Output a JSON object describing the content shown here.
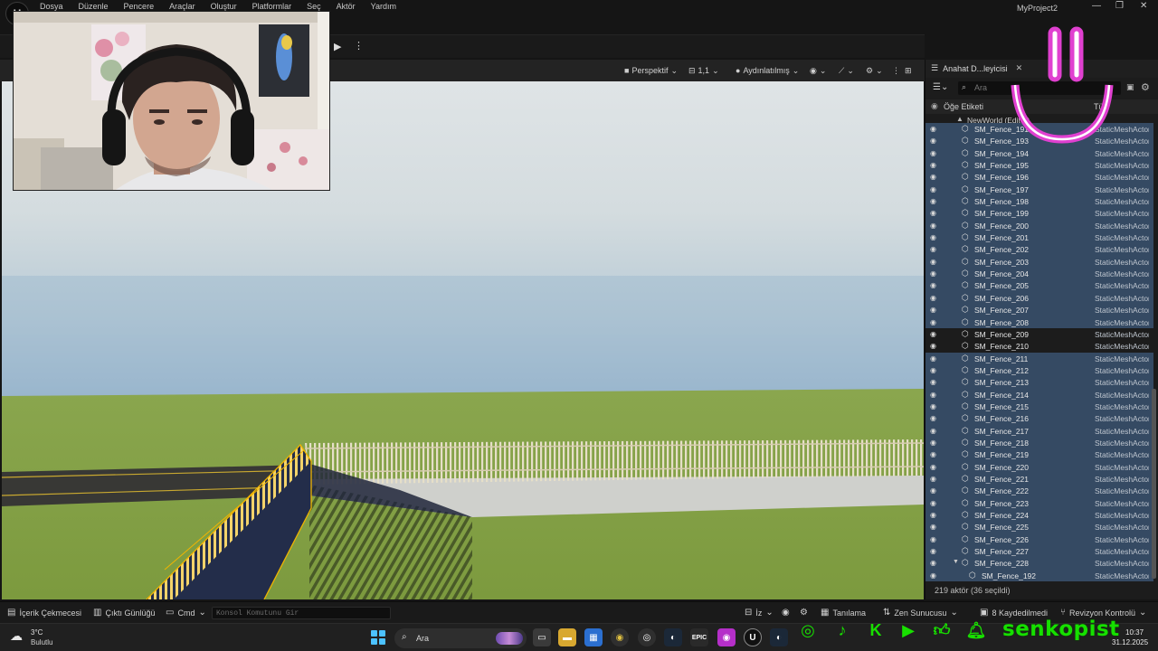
{
  "app": {
    "logo_glyph": "U",
    "menu": [
      "Dosya",
      "Düzenle",
      "Pencere",
      "Araçlar",
      "Oluştur",
      "Platformlar",
      "Seç",
      "Aktör",
      "Yardım"
    ],
    "project_title": "MyProject2",
    "window_controls": [
      "—",
      "❐",
      "✕"
    ]
  },
  "toolbar": {
    "play_glyph": "▶",
    "more_glyph": "⋮"
  },
  "viewport": {
    "view_mode": "Perspektif",
    "scale": "1,1",
    "lighting": "Aydınlatılmış",
    "show_glyph": "◉",
    "snap_glyph": "⚙",
    "layout_glyph": "⊞",
    "more_glyph": "⋮",
    "sky_color": "#c9d6dc",
    "ground_color": "#86a04a",
    "road_color": "#3a3a38",
    "fence_color": "#e4dcc4",
    "selection_color": "#f0b400"
  },
  "outliner": {
    "tab_label": "Anahat D...leyicisi",
    "tab_close": "✕",
    "search_placeholder": "Ara",
    "header_label": "Öğe Etiketi",
    "header_type": "Tür",
    "root_label": "NewWorld (Editör)",
    "rows": [
      {
        "name": "SM_Fence_191",
        "type": "StaticMeshActor",
        "selected": true
      },
      {
        "name": "SM_Fence_193",
        "type": "StaticMeshActor",
        "selected": true
      },
      {
        "name": "SM_Fence_194",
        "type": "StaticMeshActor",
        "selected": true
      },
      {
        "name": "SM_Fence_195",
        "type": "StaticMeshActor",
        "selected": true
      },
      {
        "name": "SM_Fence_196",
        "type": "StaticMeshActor",
        "selected": true
      },
      {
        "name": "SM_Fence_197",
        "type": "StaticMeshActor",
        "selected": true
      },
      {
        "name": "SM_Fence_198",
        "type": "StaticMeshActor",
        "selected": true
      },
      {
        "name": "SM_Fence_199",
        "type": "StaticMeshActor",
        "selected": true
      },
      {
        "name": "SM_Fence_200",
        "type": "StaticMeshActor",
        "selected": true
      },
      {
        "name": "SM_Fence_201",
        "type": "StaticMeshActor",
        "selected": true
      },
      {
        "name": "SM_Fence_202",
        "type": "StaticMeshActor",
        "selected": true
      },
      {
        "name": "SM_Fence_203",
        "type": "StaticMeshActor",
        "selected": true
      },
      {
        "name": "SM_Fence_204",
        "type": "StaticMeshActor",
        "selected": true
      },
      {
        "name": "SM_Fence_205",
        "type": "StaticMeshActor",
        "selected": true
      },
      {
        "name": "SM_Fence_206",
        "type": "StaticMeshActor",
        "selected": true
      },
      {
        "name": "SM_Fence_207",
        "type": "StaticMeshActor",
        "selected": true
      },
      {
        "name": "SM_Fence_208",
        "type": "StaticMeshActor",
        "selected": true
      },
      {
        "name": "SM_Fence_209",
        "type": "StaticMeshActor",
        "selected": false
      },
      {
        "name": "SM_Fence_210",
        "type": "StaticMeshActor",
        "selected": false
      },
      {
        "name": "SM_Fence_211",
        "type": "StaticMeshActor",
        "selected": true
      },
      {
        "name": "SM_Fence_212",
        "type": "StaticMeshActor",
        "selected": true
      },
      {
        "name": "SM_Fence_213",
        "type": "StaticMeshActor",
        "selected": true
      },
      {
        "name": "SM_Fence_214",
        "type": "StaticMeshActor",
        "selected": true
      },
      {
        "name": "SM_Fence_215",
        "type": "StaticMeshActor",
        "selected": true
      },
      {
        "name": "SM_Fence_216",
        "type": "StaticMeshActor",
        "selected": true
      },
      {
        "name": "SM_Fence_217",
        "type": "StaticMeshActor",
        "selected": true
      },
      {
        "name": "SM_Fence_218",
        "type": "StaticMeshActor",
        "selected": true
      },
      {
        "name": "SM_Fence_219",
        "type": "StaticMeshActor",
        "selected": true
      },
      {
        "name": "SM_Fence_220",
        "type": "StaticMeshActor",
        "selected": true
      },
      {
        "name": "SM_Fence_221",
        "type": "StaticMeshActor",
        "selected": true
      },
      {
        "name": "SM_Fence_222",
        "type": "StaticMeshActor",
        "selected": true
      },
      {
        "name": "SM_Fence_223",
        "type": "StaticMeshActor",
        "selected": true
      },
      {
        "name": "SM_Fence_224",
        "type": "StaticMeshActor",
        "selected": true
      },
      {
        "name": "SM_Fence_225",
        "type": "StaticMeshActor",
        "selected": true
      },
      {
        "name": "SM_Fence_226",
        "type": "StaticMeshActor",
        "selected": true
      },
      {
        "name": "SM_Fence_227",
        "type": "StaticMeshActor",
        "selected": true
      },
      {
        "name": "SM_Fence_228",
        "type": "StaticMeshActor",
        "selected": true,
        "expanded": true
      },
      {
        "name": "SM_Fence_192",
        "type": "StaticMeshActor",
        "selected": true,
        "child": true
      }
    ],
    "actor_count": "219 aktör (36 seçildi)",
    "selected_color": "#354a63"
  },
  "statusbar": {
    "content_drawer": "İçerik Çekmecesi",
    "output_log": "Çıktı Günlüğü",
    "cmd": "Cmd",
    "console_placeholder": "Konsol Komutunu Gir",
    "trace": "İz",
    "derived_data": "Tanılama",
    "zen_server": "Zen Sunucusu",
    "unsaved": "8 Kaydedilmedi",
    "revision_control": "Revizyon Kontrolü"
  },
  "taskbar": {
    "weather_temp": "3°C",
    "weather_desc": "Bulutlu",
    "search_label": "Ara",
    "time": "10:37",
    "date": "31.12.2025"
  },
  "overlay": {
    "brand_name": "senkopist",
    "smiley_color": "#e040d0",
    "social_color": "#18e000"
  }
}
